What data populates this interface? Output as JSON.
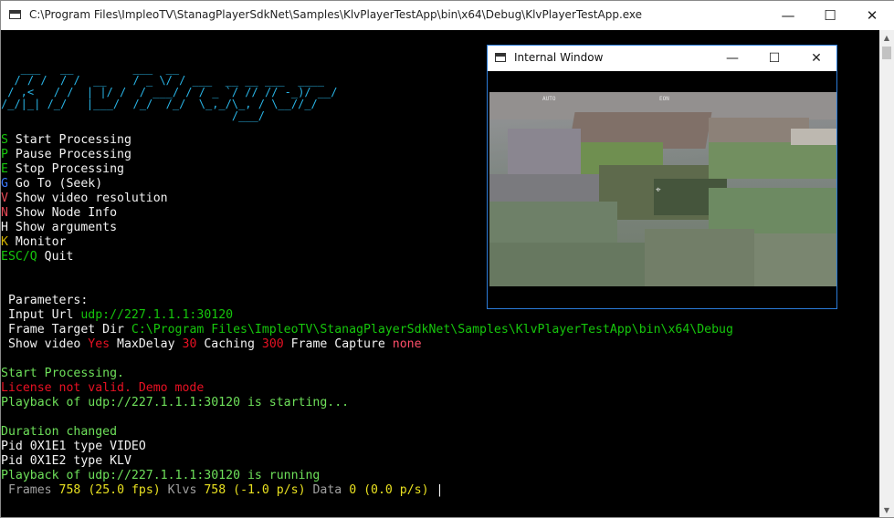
{
  "window": {
    "title": "C:\\Program Files\\ImpleoTV\\StanagPlayerSdkNet\\Samples\\KlvPlayerTestApp\\bin\\x64\\Debug\\KlvPlayerTestApp.exe",
    "minimize_glyph": "—",
    "maximize_glyph": "☐",
    "close_glyph": "✕"
  },
  "logo": {
    "text": "   ___   __         ___  __\n  / / /  / /  __    / _ \\/ / ___  __ __ ___  ____\n / ,<   / /  | |/ /  / ___/ / / _ `/ // // -_)/ __/\n/_/|_| /_/   |___/  /_/  /_/  \\_,_/\\_, / \\__//_/\n                                   /___/"
  },
  "menu": [
    {
      "key": "S",
      "label": " Start Processing"
    },
    {
      "key": "P",
      "label": " Pause Processing"
    },
    {
      "key": "E",
      "label": " Stop Processing"
    },
    {
      "key": "G",
      "label": " Go To (Seek)"
    },
    {
      "key": "V",
      "label": " Show video resolution"
    },
    {
      "key": "N",
      "label": " Show Node Info"
    },
    {
      "key": "H",
      "label": " Show arguments"
    },
    {
      "key": "K",
      "label": " Monitor"
    },
    {
      "key": "ESC/Q",
      "label": " Quit"
    }
  ],
  "params": {
    "heading": " Parameters:",
    "input_url_label": " Input Url ",
    "input_url": "udp://227.1.1.1:30120",
    "frame_dir_label": " Frame Target Dir ",
    "frame_dir": "C:\\Program Files\\ImpleoTV\\StanagPlayerSdkNet\\Samples\\KlvPlayerTestApp\\bin\\x64\\Debug",
    "show_video_label": " Show video ",
    "show_video": "Yes",
    "max_delay_label": " MaxDelay ",
    "max_delay": "30",
    "caching_label": " Caching ",
    "caching": "300",
    "frame_capture_label": " Frame Capture ",
    "frame_capture": "none"
  },
  "log": {
    "start": "Start Processing.",
    "license": "License not valid. Demo mode",
    "starting": "Playback of udp://227.1.1.1:30120 is starting...",
    "duration": "Duration changed",
    "pid1": "Pid 0X1E1 type VIDEO",
    "pid2": "Pid 0X1E2 type KLV",
    "running": "Playback of udp://227.1.1.1:30120 is running"
  },
  "status": {
    "frames_label": " Frames ",
    "frames": "758",
    "fps": "(25.0 fps)",
    "klvs_label": " Klvs ",
    "klvs": "758",
    "klv_rate": "(-1.0 p/s)",
    "data_label": " Data ",
    "data": "0",
    "data_rate": "(0.0 p/s)",
    "cursor": " |"
  },
  "inner_window": {
    "title": "Internal Window",
    "minimize_glyph": "—",
    "maximize_glyph": "☐",
    "close_glyph": "✕"
  },
  "osd": {
    "mode": "AUTO",
    "eon": "EON"
  }
}
